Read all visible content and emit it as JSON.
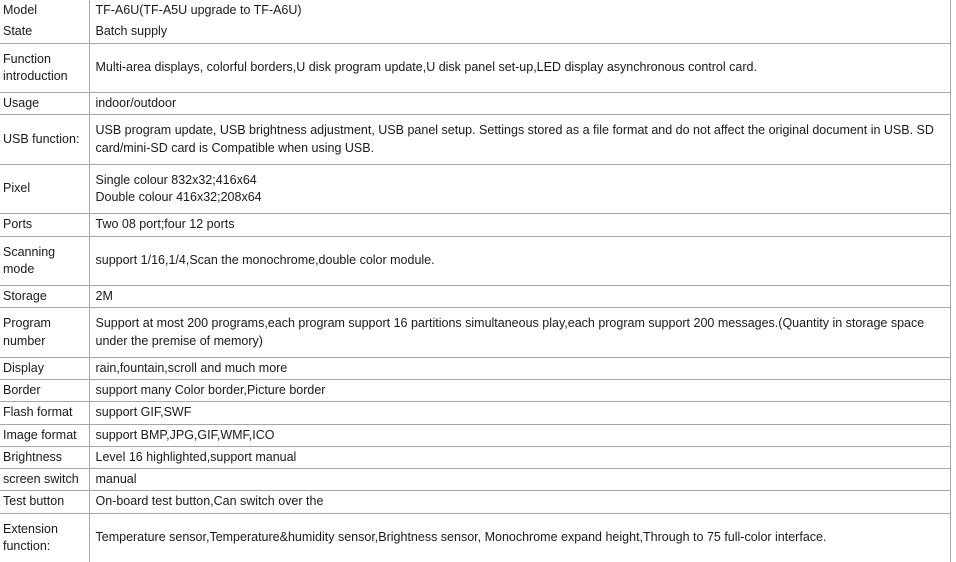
{
  "document": {
    "type": "specification-table",
    "columns": [
      "parameter",
      "value"
    ],
    "border_color": "#a6a6a6",
    "text_color": "#1a1a1a",
    "background_color": "#ffffff"
  },
  "rows": [
    {
      "label": "Model",
      "value": "TF-A6U(TF-A5U upgrade to TF-A6U)",
      "lines": [
        "TF-A6U(TF-A5U upgrade to TF-A6U)"
      ]
    },
    {
      "label": "State",
      "value": "Batch supply",
      "lines": [
        "Batch supply"
      ]
    },
    {
      "label": "Function introduction",
      "value": "Multi-area displays, colorful borders,U disk program update,U disk panel set-up,LED display asynchronous control card.",
      "lines": [
        "Multi-area displays, colorful borders,U disk program update,U disk panel set-up,LED display asynchronous control card."
      ]
    },
    {
      "label": "Usage",
      "value": "indoor/outdoor",
      "lines": [
        "indoor/outdoor"
      ]
    },
    {
      "label": "USB function:",
      "value": "USB program update, USB brightness adjustment, USB panel setup. Settings stored as a file format and do not affect the original document in USB. SD card/mini-SD card is Compatible when using USB.",
      "lines": [
        "USB program update, USB brightness adjustment, USB panel setup. Settings stored as a file format and do not affect the original document in USB. SD card/mini-SD card is Compatible when using USB."
      ]
    },
    {
      "label": "Pixel",
      "value": "Single colour 832x32;416x64 Double colour 416x32;208x64",
      "lines": [
        "Single colour 832x32;416x64",
        "Double colour 416x32;208x64"
      ]
    },
    {
      "label": "Ports",
      "value": "Two 08 port;four 12 ports",
      "lines": [
        "Two 08 port;four 12 ports"
      ]
    },
    {
      "label": "Scanning mode",
      "value": "support 1/16,1/4,Scan the monochrome,double color module.",
      "lines": [
        "support 1/16,1/4,Scan the monochrome,double color module."
      ]
    },
    {
      "label": "Storage",
      "value": "2M",
      "lines": [
        "2M"
      ]
    },
    {
      "label": "Program number",
      "value": "Support at most 200 programs,each program support 16 partitions simultaneous play,each program support 200 messages.(Quantity in storage space under the premise of memory)",
      "lines": [
        "Support at most 200 programs,each program support 16 partitions simultaneous play,each program support 200 messages.(Quantity in storage space under the premise of memory)"
      ]
    },
    {
      "label": "Display",
      "value": "rain,fountain,scroll and much more",
      "lines": [
        "rain,fountain,scroll and much more"
      ]
    },
    {
      "label": "Border",
      "value": "support many Color border,Picture border",
      "lines": [
        "support many Color border,Picture border"
      ]
    },
    {
      "label": "Flash format",
      "value": "support GIF,SWF",
      "lines": [
        "support GIF,SWF"
      ]
    },
    {
      "label": "Image format",
      "value": "support BMP,JPG,GIF,WMF,ICO",
      "lines": [
        "support BMP,JPG,GIF,WMF,ICO"
      ]
    },
    {
      "label": "Brightness",
      "value": "Level 16 highlighted,support manual",
      "lines": [
        "Level 16 highlighted,support manual"
      ]
    },
    {
      "label": "screen switch",
      "value": "manual",
      "lines": [
        "manual"
      ]
    },
    {
      "label": "Test button",
      "value": "On-board test button,Can switch over the",
      "lines": [
        "On-board test button,Can switch over the"
      ]
    },
    {
      "label": "Extension function:",
      "value": "Temperature sensor,Temperature&humidity sensor,Brightness sensor, Monochrome expand height,Through to 75 full-color interface.",
      "lines": [
        "Temperature sensor,Temperature&humidity sensor,Brightness sensor, Monochrome expand height,Through to 75 full-color interface."
      ]
    }
  ]
}
